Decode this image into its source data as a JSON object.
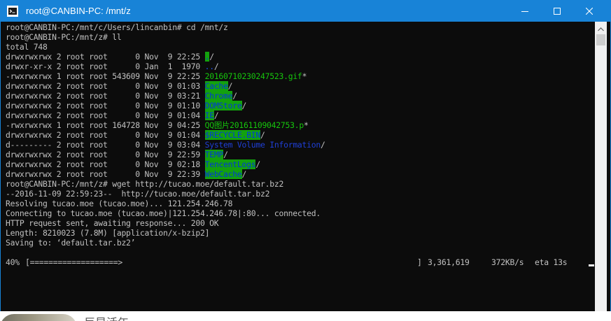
{
  "window": {
    "title": "root@CANBIN-PC: /mnt/z",
    "title_color": "#ffffff",
    "titlebar_color": "#1883d7",
    "icons": {
      "app": "terminal-icon",
      "minimize": "minimize-icon",
      "maximize": "maximize-icon",
      "close": "close-icon"
    }
  },
  "terminal": {
    "background": "#0c0c0c",
    "foreground": "#c0c0c0",
    "lines": [
      {
        "text": "root@CANBIN-PC:/mnt/c/Users/lincanbin# cd /mnt/z"
      },
      {
        "text": "root@CANBIN-PC:/mnt/z# ll"
      },
      {
        "text": "total 748"
      },
      {
        "perm": "drwxrwxrwx",
        "links": "2",
        "user": "root",
        "group": "root",
        "size": "0",
        "date": "Nov  9 22:25",
        "name": ".",
        "suffix": "/",
        "style": "dir"
      },
      {
        "perm": "drwxr-xr-x",
        "links": "2",
        "user": "root",
        "group": "root",
        "size": "0",
        "date": "Jan  1  1970",
        "name": "..",
        "suffix": "/",
        "style": "dirplain"
      },
      {
        "perm": "-rwxrwxrwx",
        "links": "1",
        "user": "root",
        "group": "root",
        "size": "543609",
        "date": "Nov  9 22:25",
        "name": "20160710230247523.gif",
        "suffix": "*",
        "style": "exec"
      },
      {
        "perm": "drwxrwxrwx",
        "links": "2",
        "user": "root",
        "group": "root",
        "size": "0",
        "date": "Nov  9 01:03",
        "name": "Cache",
        "suffix": "/",
        "style": "dir"
      },
      {
        "perm": "drwxrwxrwx",
        "links": "2",
        "user": "root",
        "group": "root",
        "size": "0",
        "date": "Nov  9 03:21",
        "name": "Chrome",
        "suffix": "/",
        "style": "dir"
      },
      {
        "perm": "drwxrwxrwx",
        "links": "2",
        "user": "root",
        "group": "root",
        "size": "0",
        "date": "Nov  9 01:10",
        "name": "DOMStore",
        "suffix": "/",
        "style": "dir"
      },
      {
        "perm": "drwxrwxrwx",
        "links": "2",
        "user": "root",
        "group": "root",
        "size": "0",
        "date": "Nov  9 01:04",
        "name": "IE",
        "suffix": "/",
        "style": "dir"
      },
      {
        "perm": "-rwxrwxrwx",
        "links": "1",
        "user": "root",
        "group": "root",
        "size": "164728",
        "date": "Nov  9 04:25",
        "name": "QQ图片20161109042753.p",
        "suffix": "*",
        "style": "exec"
      },
      {
        "perm": "drwxrwxrwx",
        "links": "2",
        "user": "root",
        "group": "root",
        "size": "0",
        "date": "Nov  9 01:04",
        "name": "$RECYCLE.BIN",
        "suffix": "/",
        "style": "dir"
      },
      {
        "perm": "d---------",
        "links": "2",
        "user": "root",
        "group": "root",
        "size": "0",
        "date": "Nov  9 03:04",
        "name": "System Volume Information",
        "suffix": "/",
        "style": "dirblue"
      },
      {
        "perm": "drwxrwxrwx",
        "links": "2",
        "user": "root",
        "group": "root",
        "size": "0",
        "date": "Nov  9 22:59",
        "name": "TEMP",
        "suffix": "/",
        "style": "dir"
      },
      {
        "perm": "drwxrwxrwx",
        "links": "2",
        "user": "root",
        "group": "root",
        "size": "0",
        "date": "Nov  9 02:18",
        "name": "TencentLogs",
        "suffix": "/",
        "style": "dir"
      },
      {
        "perm": "drwxrwxrwx",
        "links": "2",
        "user": "root",
        "group": "root",
        "size": "0",
        "date": "Nov  9 22:39",
        "name": "WebCache",
        "suffix": "/",
        "style": "dir"
      },
      {
        "text": "root@CANBIN-PC:/mnt/z# wget http://tucao.moe/default.tar.bz2"
      },
      {
        "text": "--2016-11-09 22:59:23--  http://tucao.moe/default.tar.bz2"
      },
      {
        "text": "Resolving tucao.moe (tucao.moe)... 121.254.246.78"
      },
      {
        "text": "Connecting to tucao.moe (tucao.moe)|121.254.246.78|:80... connected."
      },
      {
        "text": "HTTP request sent, awaiting response... 200 OK"
      },
      {
        "text": "Length: 8210023 (7.8M) [application/x-bzip2]"
      },
      {
        "text": "Saving to: ‘default.tar.bz2’"
      },
      {
        "text": ""
      }
    ],
    "progress": {
      "percent_label": "40%",
      "bar": "[===================>",
      "bar_end": "]",
      "bytes": "3,361,619",
      "speed": "372KB/s",
      "eta": "eta 13s"
    }
  },
  "background_strip": {
    "text": "巨星活年"
  }
}
